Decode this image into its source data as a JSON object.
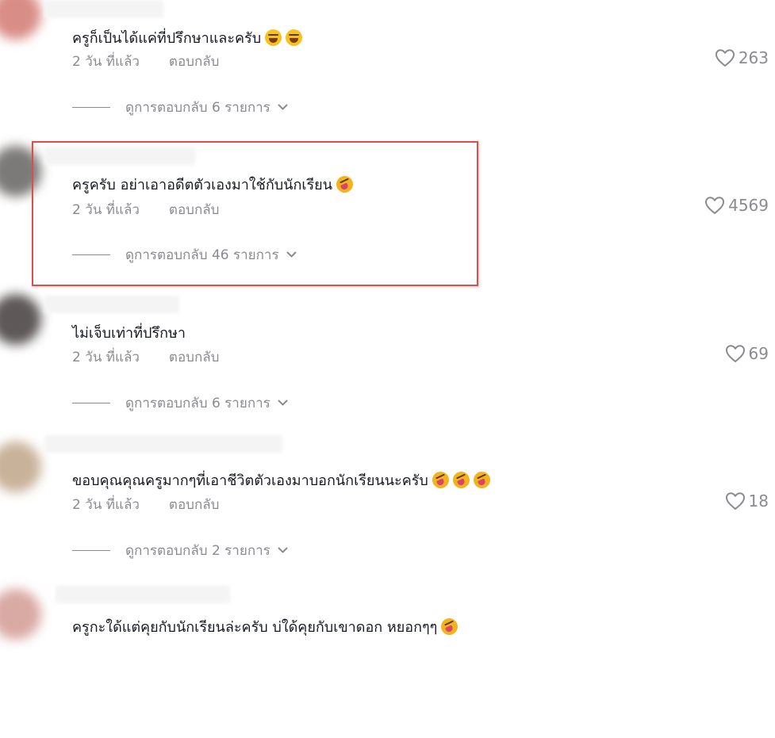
{
  "comments": [
    {
      "text": "ครูก็เป็นได้แค่ที่ปรึกษาและครับ",
      "emojis": [
        "joy-emoji",
        "joy-emoji"
      ],
      "time": "2 วัน ที่แล้ว",
      "reply_label": "ตอบกลับ",
      "likes": "263",
      "view_replies": "ดูการตอบกลับ 6 รายการ"
    },
    {
      "text": "ครูครับ อย่าเอาอดีตตัวเองมาใช้กับนักเรียน",
      "emojis": [
        "rofl-emoji"
      ],
      "time": "2 วัน ที่แล้ว",
      "reply_label": "ตอบกลับ",
      "likes": "4569",
      "view_replies": "ดูการตอบกลับ 46 รายการ"
    },
    {
      "text": "ไม่เจ็บเท่าที่ปรึกษา",
      "emojis": [],
      "time": "2 วัน ที่แล้ว",
      "reply_label": "ตอบกลับ",
      "likes": "69",
      "view_replies": "ดูการตอบกลับ 6 รายการ"
    },
    {
      "text": "ขอบคุณคุณครูมากๆที่เอาชีวิตตัวเองมาบอกนักเรียนนะครับ",
      "emojis": [
        "rofl-emoji",
        "rofl-emoji",
        "rofl-emoji"
      ],
      "time": "2 วัน ที่แล้ว",
      "reply_label": "ตอบกลับ",
      "likes": "18",
      "view_replies": "ดูการตอบกลับ 2 รายการ"
    },
    {
      "text": "ครูกะใด้แต่คุยกับนักเรียนล่ะครับ บ่ใด้คุยกับเขาดอก หยอกๆๆ",
      "emojis": [
        "rofl-emoji"
      ],
      "time": "",
      "reply_label": "",
      "likes": "",
      "view_replies": ""
    }
  ],
  "icons": {
    "like": "heart-outline-icon",
    "expand": "chevron-down-icon"
  },
  "colors": {
    "text": "#161823",
    "muted": "#8a8b91",
    "highlight_border": "#d9504c"
  }
}
